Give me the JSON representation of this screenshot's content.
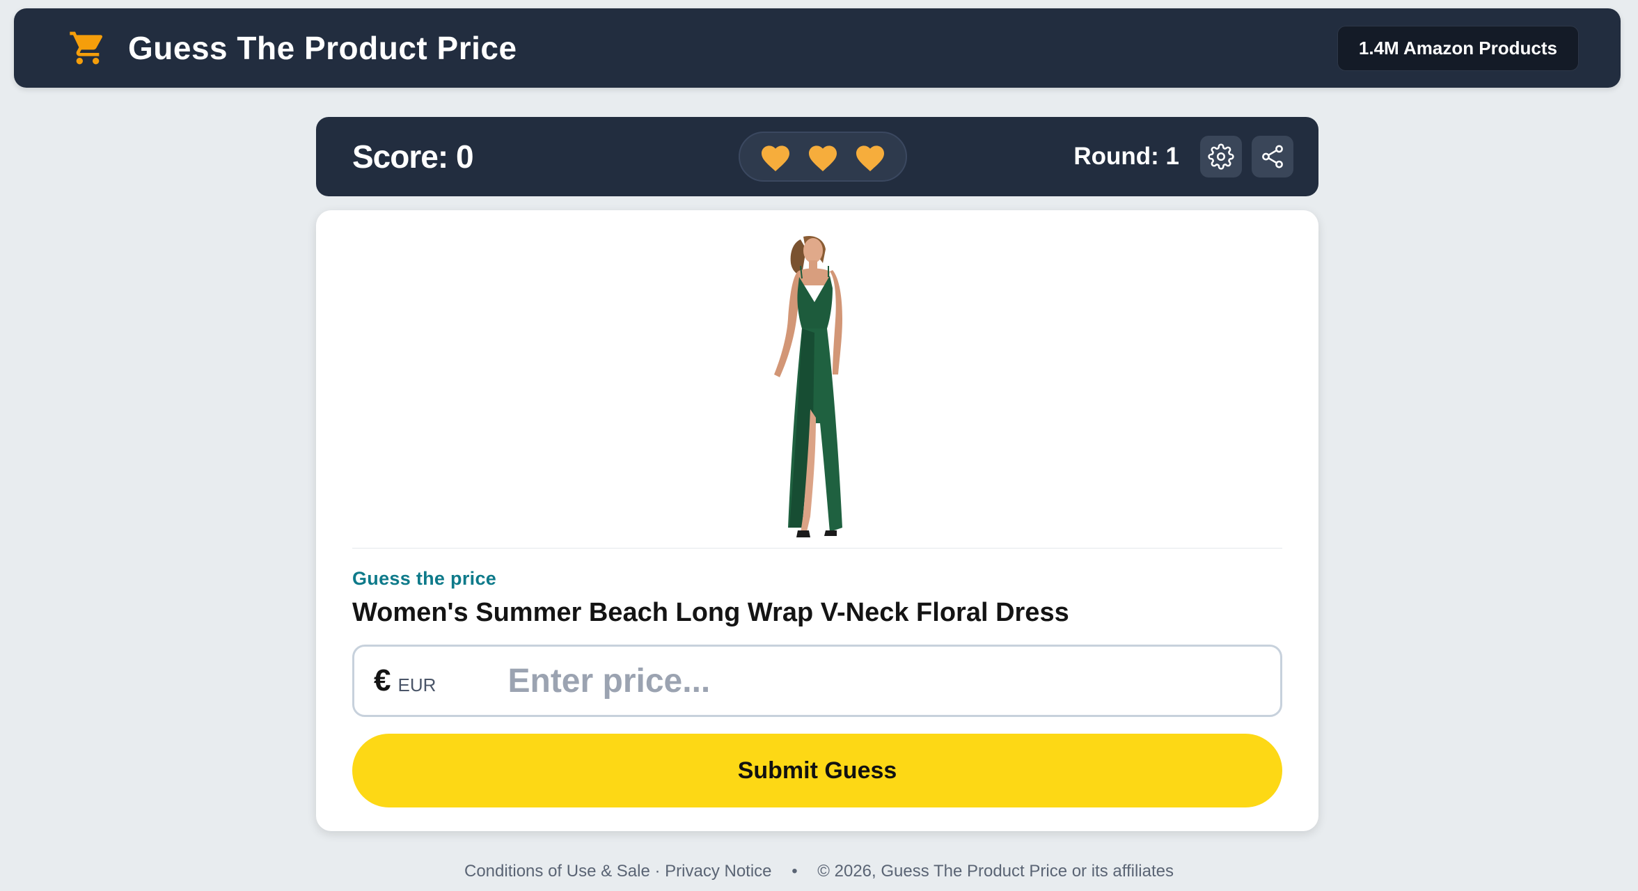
{
  "header": {
    "title": "Guess The Product Price",
    "badge": "1.4M Amazon Products",
    "icon": "cart-icon",
    "icon_color": "#f59e0b"
  },
  "scoreboard": {
    "score": "Score: 0",
    "lives": 3,
    "heart_color": "#f6ad3c",
    "round": "Round: 1",
    "settings_icon": "gear-icon",
    "share_icon": "share-icon"
  },
  "game": {
    "image_alt": "green wrap dress product image",
    "label": "Guess the price",
    "product_title": "Women's Summer Beach Long Wrap V-Neck Floral Dress",
    "currency_symbol": "€",
    "currency_code": "EUR",
    "price_value": "",
    "price_placeholder": "Enter price...",
    "submit_label": "Submit Guess",
    "submit_color": "#fdd815"
  },
  "footer": {
    "terms": "Conditions of Use & Sale",
    "separator": "·",
    "privacy": "Privacy Notice",
    "bullet": "•",
    "copyright": "© 2026, Guess The Product Price or its affiliates"
  }
}
